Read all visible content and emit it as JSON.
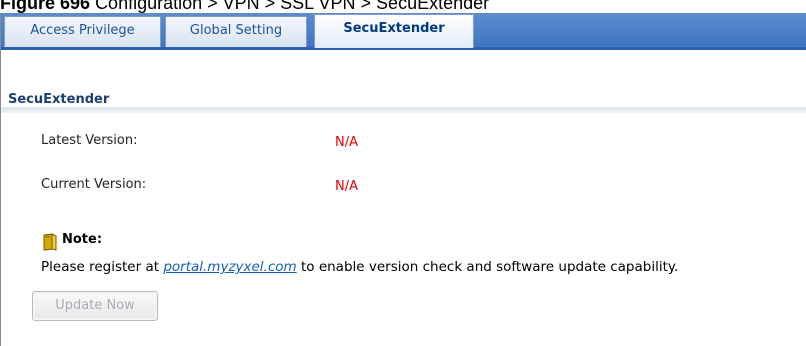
{
  "caption": {
    "figure": "Figure 696",
    "path": "Configuration > VPN > SSL VPN > SecuExtender"
  },
  "tabs": [
    {
      "label": "Access Privilege",
      "active": false
    },
    {
      "label": "Global Setting",
      "active": false
    },
    {
      "label": "SecuExtender",
      "active": true
    }
  ],
  "section": {
    "title": "SecuExtender"
  },
  "fields": {
    "latest_label": "Latest Version:",
    "latest_value": "N/A",
    "current_label": "Current Version:",
    "current_value": "N/A"
  },
  "note": {
    "title": "Note:",
    "text_before": "Please register at ",
    "link_text": "portal.myzyxel.com",
    "text_after": " to enable version check and software update capability.",
    "icon": "note-icon"
  },
  "buttons": {
    "update_label": "Update Now",
    "update_disabled": true
  },
  "colors": {
    "tab_bar": "#3f75c2",
    "value_text": "#e40000",
    "link": "#1560b8",
    "section_title": "#1a3f73"
  }
}
